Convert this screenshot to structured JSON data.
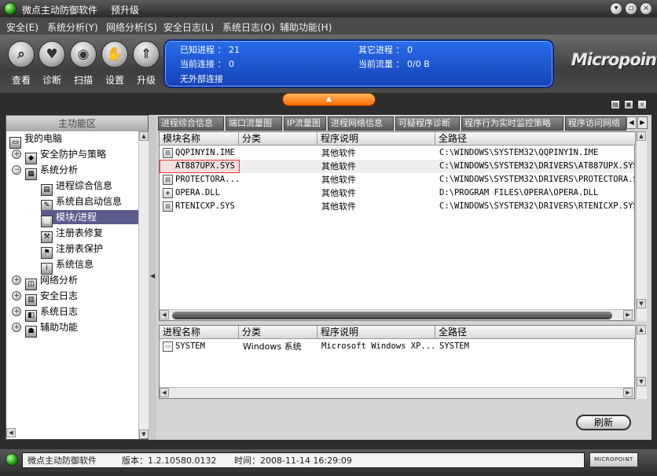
{
  "window": {
    "title": "微点主动防御软件",
    "badge": "预升级"
  },
  "menu": [
    "安全(E)",
    "系统分析(Y)",
    "网络分析(S)",
    "安全日志(L)",
    "系统日志(O)",
    "辅助功能(H)"
  ],
  "toolbar": [
    {
      "label": "查看",
      "icon": "magnifier-icon"
    },
    {
      "label": "诊断",
      "icon": "heart-icon"
    },
    {
      "label": "扫描",
      "icon": "scan-icon"
    },
    {
      "label": "设置",
      "icon": "hand-icon"
    },
    {
      "label": "升级",
      "icon": "upgrade-icon"
    }
  ],
  "status": {
    "known_processes": "已知进程 ： 21",
    "other_processes": "其它进程 ： 0",
    "current_connections": "当前连接 ： 0",
    "current_traffic": "当前流量 ： 0/0 B",
    "no_external": "无外部连接"
  },
  "logo": "Micropoint",
  "left": {
    "header": "主功能区",
    "items": [
      {
        "label": "我的电脑",
        "level": 0,
        "expander": "",
        "selected": false,
        "icon": "computer-icon"
      },
      {
        "label": "安全防护与策略",
        "level": 1,
        "expander": "+",
        "selected": false,
        "icon": "shield-icon"
      },
      {
        "label": "系统分析",
        "level": 1,
        "expander": "−",
        "selected": false,
        "icon": "system-icon"
      },
      {
        "label": "进程综合信息",
        "level": 2,
        "expander": "",
        "selected": false,
        "icon": "process-icon"
      },
      {
        "label": "系统自启动信息",
        "level": 2,
        "expander": "",
        "selected": false,
        "icon": "startup-icon"
      },
      {
        "label": "模块/进程",
        "level": 2,
        "expander": "",
        "selected": true,
        "icon": "module-icon"
      },
      {
        "label": "注册表修复",
        "level": 2,
        "expander": "",
        "selected": false,
        "icon": "registry-repair-icon"
      },
      {
        "label": "注册表保护",
        "level": 2,
        "expander": "",
        "selected": false,
        "icon": "registry-protect-icon"
      },
      {
        "label": "系统信息",
        "level": 2,
        "expander": "",
        "selected": false,
        "icon": "info-icon"
      },
      {
        "label": "网络分析",
        "level": 1,
        "expander": "+",
        "selected": false,
        "icon": "network-icon"
      },
      {
        "label": "安全日志",
        "level": 1,
        "expander": "+",
        "selected": false,
        "icon": "security-log-icon"
      },
      {
        "label": "系统日志",
        "level": 1,
        "expander": "+",
        "selected": false,
        "icon": "system-log-icon"
      },
      {
        "label": "辅助功能",
        "level": 1,
        "expander": "+",
        "selected": false,
        "icon": "tools-icon"
      }
    ]
  },
  "tabs": [
    "进程综合信息",
    "端口流量图",
    "IP流量图",
    "进程网络信息",
    "可疑程序诊断",
    "程序行为实时监控策略",
    "程序访问网络"
  ],
  "modules": {
    "columns": [
      "模块名称",
      "分类",
      "程序说明",
      "全路径"
    ],
    "rows": [
      [
        "QQPINYIN.IME",
        "",
        "其他软件",
        "C:\\WINDOWS\\SYSTEM32\\QQPINYIN.IME"
      ],
      [
        "AT887UPX.SYS",
        "",
        "其他软件",
        "C:\\WINDOWS\\SYSTEM32\\DRIVERS\\AT887UPX.SYS"
      ],
      [
        "PROTECTORA...",
        "",
        "其他软件",
        "C:\\WINDOWS\\SYSTEM32\\DRIVERS\\PROTECTORA.SYS"
      ],
      [
        "OPERA.DLL",
        "",
        "其他软件",
        "D:\\PROGRAM FILES\\OPERA\\OPERA.DLL"
      ],
      [
        "RTENICXP.SYS",
        "",
        "其他软件",
        "C:\\WINDOWS\\SYSTEM32\\DRIVERS\\RTENICXP.SYS"
      ]
    ]
  },
  "processes": {
    "columns": [
      "进程名称",
      "分类",
      "程序说明",
      "全路径"
    ],
    "rows": [
      [
        "SYSTEM",
        "Windows 系统",
        "Microsoft Windows XP...",
        "SYSTEM"
      ]
    ]
  },
  "refresh_label": "刷新",
  "statusbar": {
    "app": "微点主动防御软件",
    "version": "版本：1.2.10580.0132",
    "time": "时间：2008-11-14 16:29:09",
    "logo": "MICROPOINT"
  }
}
